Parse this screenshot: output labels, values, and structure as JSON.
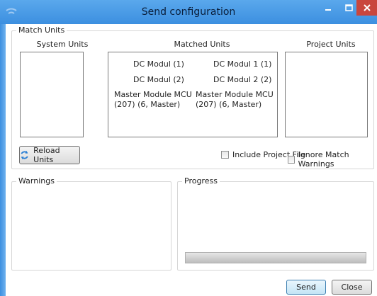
{
  "window": {
    "title": "Send configuration"
  },
  "match_units": {
    "group_label": "Match Units",
    "system_units_header": "System Units",
    "matched_units_header": "Matched Units",
    "project_units_header": "Project Units",
    "system_units": [],
    "project_units": [],
    "matched": [
      {
        "system": "DC Modul (1)",
        "project": "DC Modul 1 (1)"
      },
      {
        "system": "DC Modul (2)",
        "project": "DC Modul 2 (2)"
      },
      {
        "system": "Master Module MCU (207) (6, Master)",
        "project": "Master Module MCU (207) (6, Master)"
      }
    ],
    "reload_button": "Reload Units",
    "include_project_file": {
      "label": "Include Project File",
      "checked": false
    },
    "ignore_match_warnings": {
      "label": "Ignore Match Warnings",
      "checked": false
    }
  },
  "warnings": {
    "group_label": "Warnings"
  },
  "progress": {
    "group_label": "Progress",
    "value": 0
  },
  "footer": {
    "send_label": "Send",
    "close_label": "Close"
  }
}
